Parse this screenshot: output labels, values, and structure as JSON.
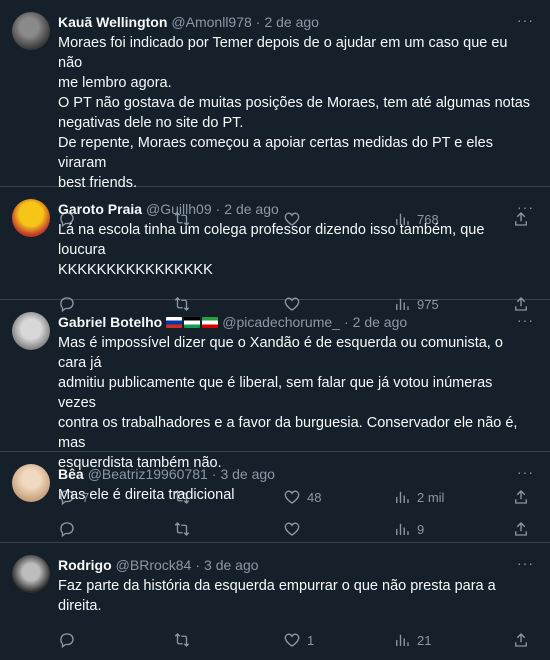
{
  "tweets": [
    {
      "name": "Kauã Wellington",
      "handle": "@Amonll978",
      "time": "2 de ago",
      "lines": [
        "Moraes foi indicado por Temer depois de o ajudar em um caso que eu não",
        "me lembro agora.",
        "O PT não gostava de muitas posições de Moraes, tem até algumas notas",
        "negativas dele no site do PT.",
        "De repente, Moraes começou a apoiar certas medidas do PT e eles viraram",
        "best friends."
      ],
      "replies": "",
      "retweets": "",
      "likes": "",
      "views": "768"
    },
    {
      "name": "Garoto Praia",
      "handle": "@Guillh09",
      "time": "2 de ago",
      "lines": [
        "Lá na escola tinha um colega professor dizendo isso também, que loucura",
        "KKKKKKKKKKKKKKKK"
      ],
      "replies": "",
      "retweets": "",
      "likes": "",
      "views": "975"
    },
    {
      "name": "Gabriel Botelho",
      "handle": "@picadechorume_",
      "time": "2 de ago",
      "lines": [
        "Mas é impossível dizer que o Xandão é de esquerda ou comunista, o cara já",
        "admitiu publicamente que é liberal, sem falar que já votou inúmeras vezes",
        "contra os trabalhadores e a favor da burguesia. Conservador ele não é, mas",
        "esquerdista também não."
      ],
      "replies": "7",
      "retweets": "",
      "likes": "48",
      "views": "2 mil"
    },
    {
      "name": "Bêa",
      "handle": "@Beatriz19960781",
      "time": "3 de ago",
      "lines": [
        "Mas ele é direita tradicional"
      ],
      "replies": "",
      "retweets": "",
      "likes": "",
      "views": "9"
    },
    {
      "name": "Rodrigo",
      "handle": "@BRrock84",
      "time": "3 de ago",
      "lines": [
        "Faz parte da história da esquerda empurrar o que não presta para a direita."
      ],
      "replies": "",
      "retweets": "",
      "likes": "1",
      "views": "21"
    }
  ],
  "icons": {
    "reply": "reply-icon",
    "retweet": "retweet-icon",
    "like": "heart-icon",
    "views": "views-icon",
    "share": "share-icon",
    "more": "more-icon"
  },
  "colors": {
    "background": "#15202b",
    "divider": "#38444d",
    "muted": "#8b98a5",
    "text": "#f7f9f9"
  }
}
